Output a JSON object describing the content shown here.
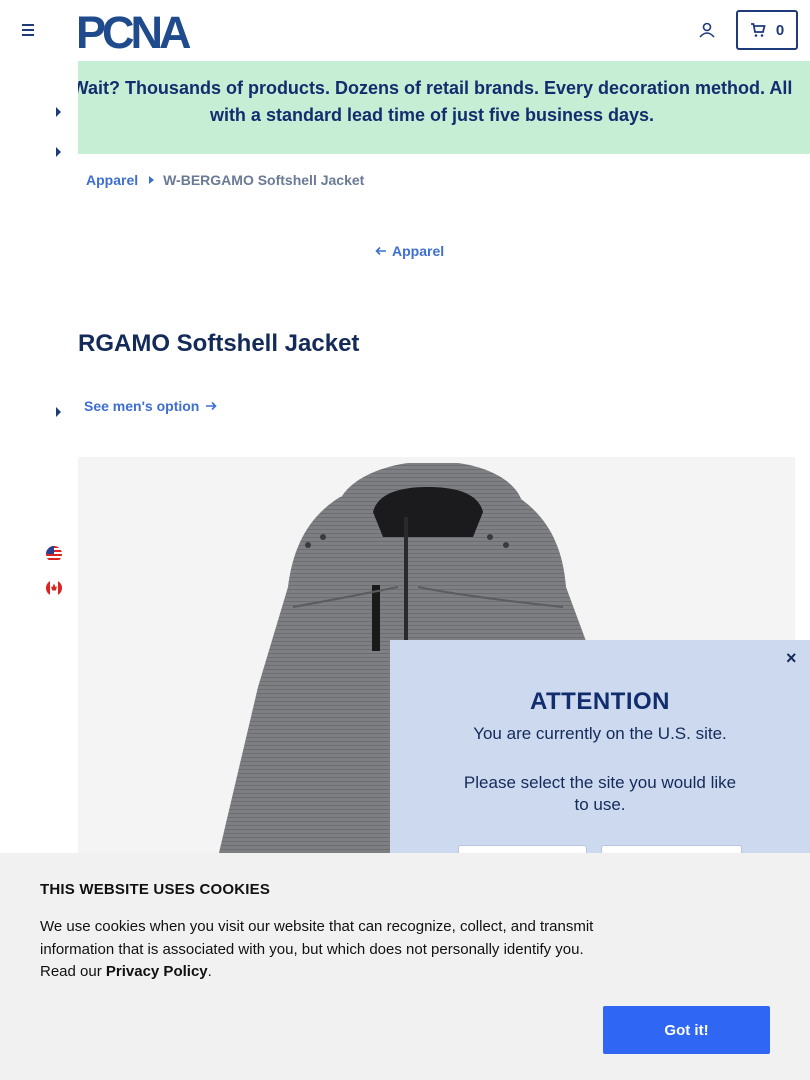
{
  "header": {
    "logo_text": "PCNA",
    "cart_count": "0"
  },
  "banner": {
    "text": "Wait? Thousands of products. Dozens of retail brands. Every decoration method. All with a standard lead time of just five business days."
  },
  "breadcrumb": {
    "parent": "Apparel",
    "current": "W-BERGAMO Softshell Jacket"
  },
  "back_link": {
    "label": "Apparel"
  },
  "product": {
    "title": "RGAMO Softshell Jacket",
    "mens_option_label": "See men's option"
  },
  "site_popup": {
    "title": "ATTENTION",
    "line1": "You are currently on the U.S. site.",
    "line2": "Please select the site you would like to use.",
    "close_label": "×"
  },
  "cookie_notice": {
    "title": "THIS WEBSITE USES COOKIES",
    "text": "We use cookies when you visit our website that can recognize, collect, and transmit information that is associated with you, but which does not personally identify you. Read our",
    "policy_link": "Privacy Policy",
    "period": ".",
    "button_label": "Got it!"
  },
  "colors": {
    "brand_navy": "#1f3a7a",
    "link_blue": "#3d6fd0",
    "banner_green": "#c6eed4",
    "popup_blue": "#ccd9ef",
    "cookie_button": "#2f66f4"
  }
}
